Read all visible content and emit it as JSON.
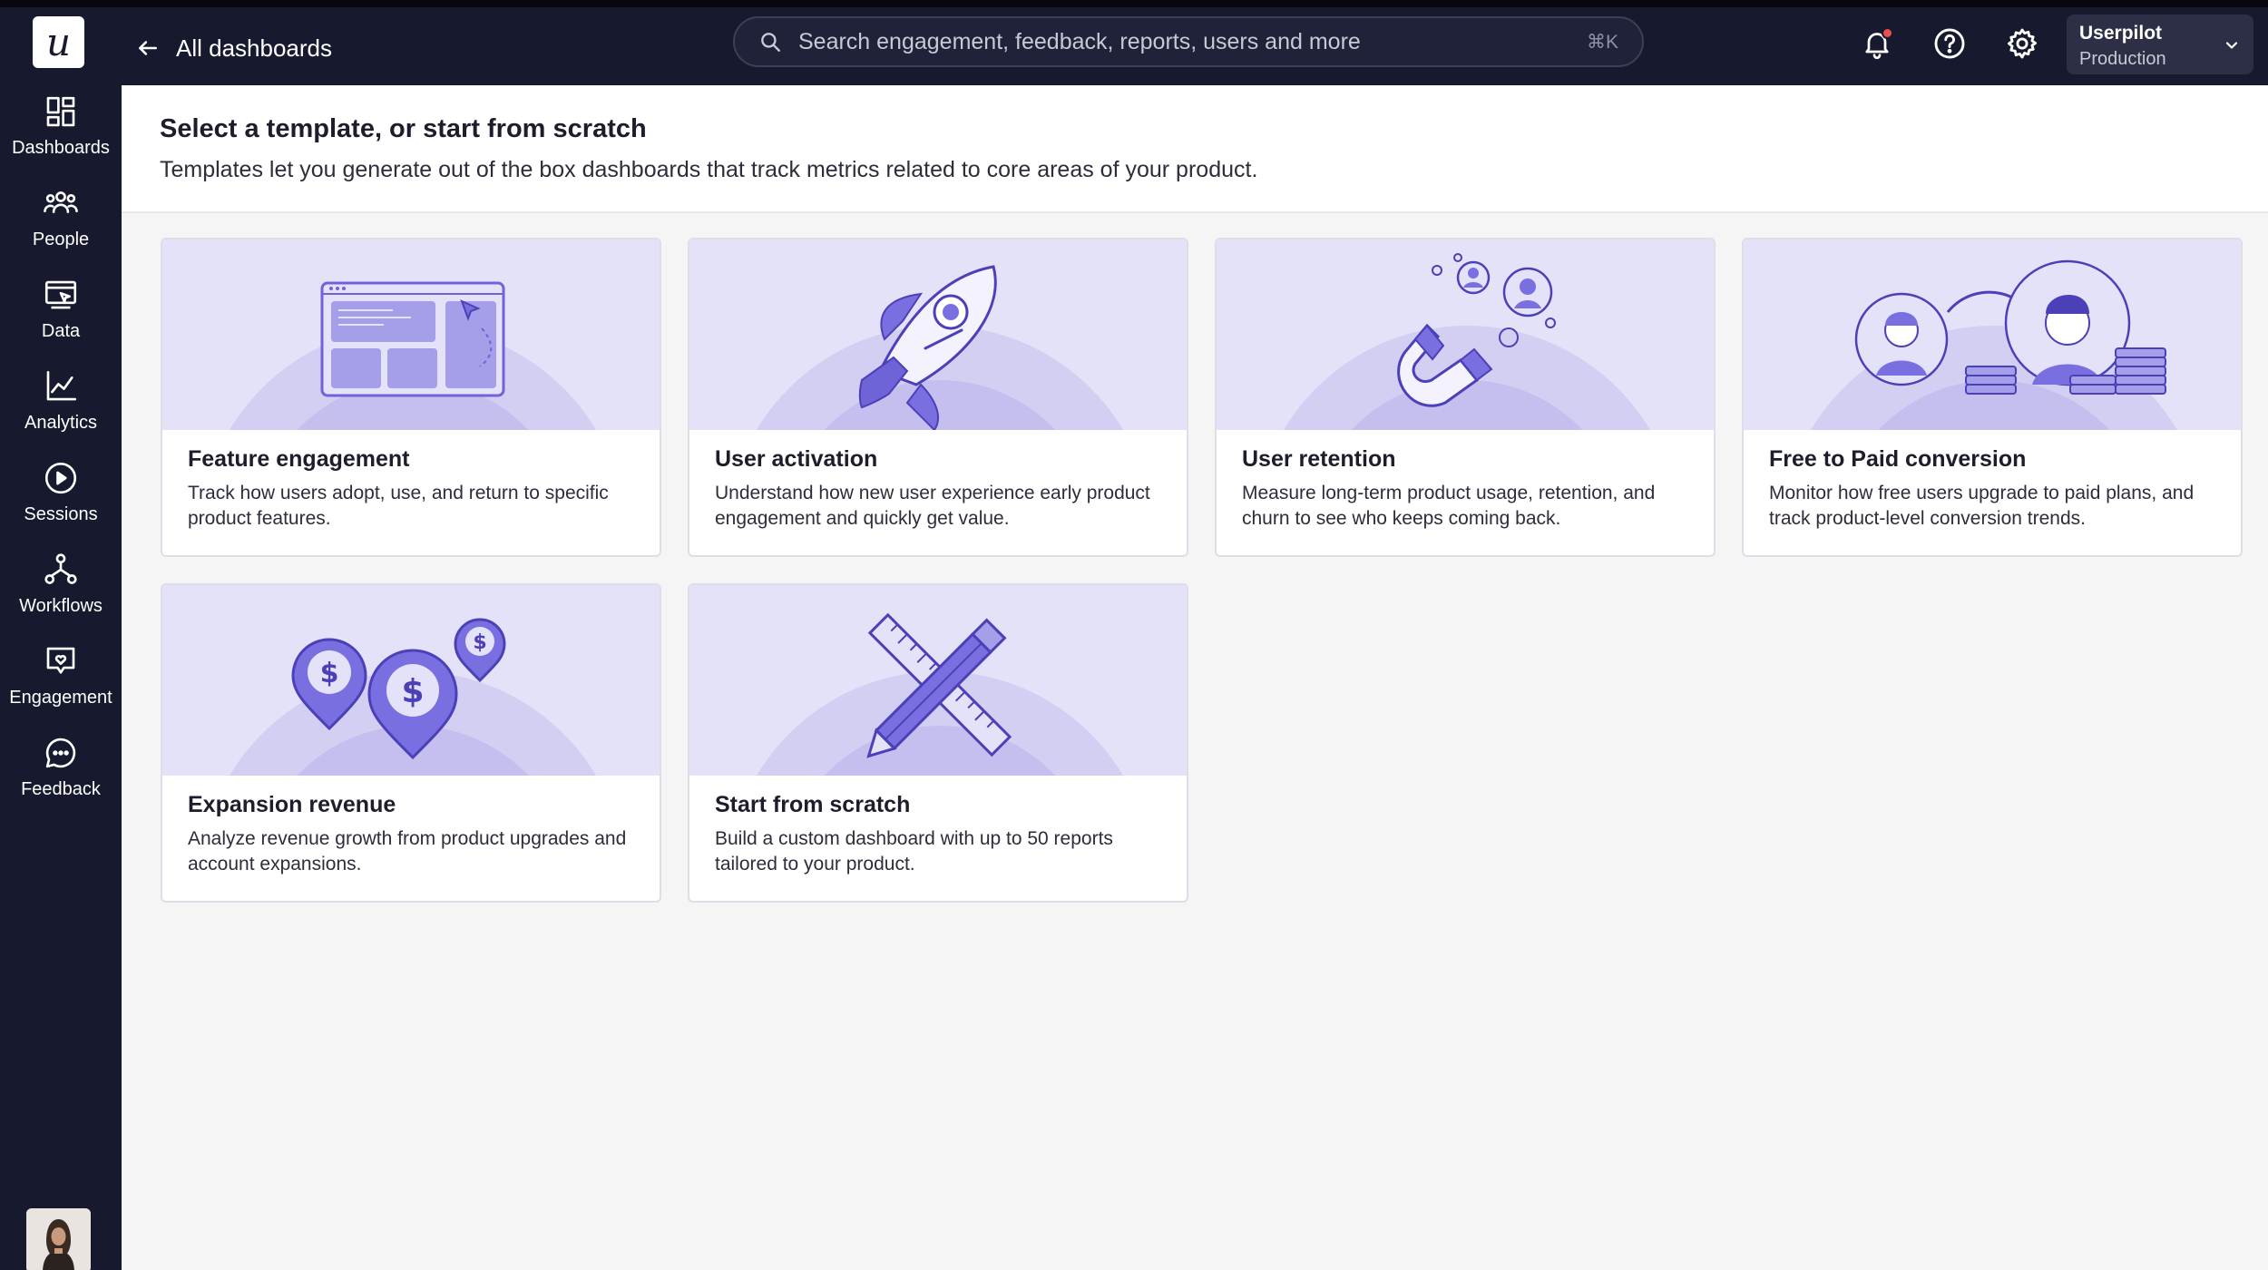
{
  "topbar": {
    "logo": "u",
    "back_label": "All dashboards",
    "search_placeholder": "Search engagement, feedback, reports, users and more",
    "search_shortcut": "⌘K",
    "icons": [
      "bell-icon",
      "help-icon",
      "gear-icon"
    ],
    "account": {
      "name": "Userpilot",
      "environment": "Production"
    }
  },
  "sidebar": {
    "items": [
      {
        "label": "Dashboards",
        "icon": "dashboards-icon"
      },
      {
        "label": "People",
        "icon": "people-icon"
      },
      {
        "label": "Data",
        "icon": "data-icon"
      },
      {
        "label": "Analytics",
        "icon": "analytics-icon"
      },
      {
        "label": "Sessions",
        "icon": "sessions-icon"
      },
      {
        "label": "Workflows",
        "icon": "workflows-icon"
      },
      {
        "label": "Engagement",
        "icon": "engagement-icon"
      },
      {
        "label": "Feedback",
        "icon": "feedback-icon"
      }
    ]
  },
  "header": {
    "title": "Select a template, or start from scratch",
    "subtitle": "Templates let you generate out of the box dashboards that track metrics related to core areas of your product."
  },
  "templates": [
    {
      "title": "Feature engagement",
      "description": "Track how users adopt, use, and return to specific product features."
    },
    {
      "title": "User activation",
      "description": "Understand how new user experience early product engagement and quickly get value."
    },
    {
      "title": "User retention",
      "description": "Measure long-term product usage, retention, and churn to see who keeps coming back."
    },
    {
      "title": "Free to Paid conversion",
      "description": "Monitor how free users upgrade to paid plans, and track product-level conversion trends."
    },
    {
      "title": "Expansion revenue",
      "description": "Analyze revenue growth from product upgrades and account expansions."
    },
    {
      "title": "Start from scratch",
      "description": "Build a custom dashboard with up to 50 reports tailored to your product."
    }
  ],
  "colors": {
    "topbar_bg": "#171a2e",
    "illustration_bg": "#e4e2f8",
    "illustration_ring_outer": "#d3cff3",
    "illustration_ring_middle": "#c4bfef",
    "illustration_ring_inner": "#b5afea",
    "illustration_accent": "#7a6fe0",
    "notification_dot": "#ec4e4e"
  }
}
